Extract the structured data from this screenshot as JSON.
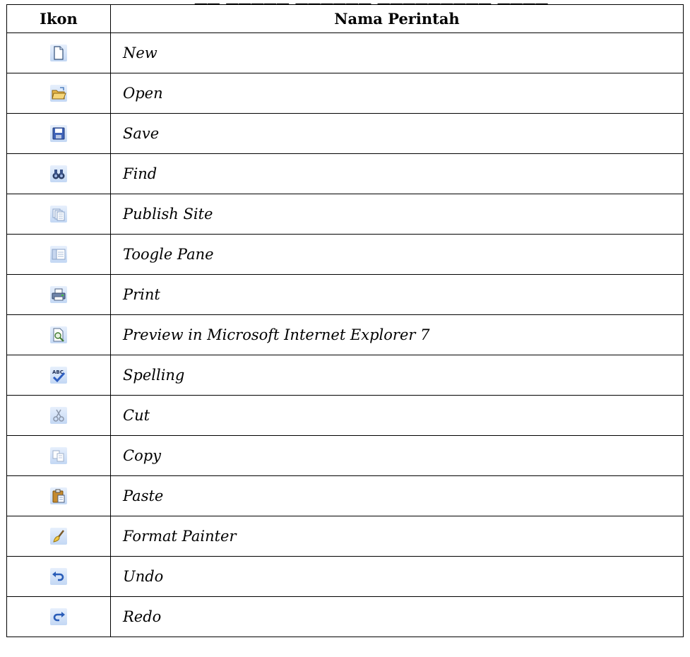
{
  "table": {
    "headers": {
      "icon": "Ikon",
      "name": "Nama Perintah"
    },
    "rows": [
      {
        "icon": "new-document-icon",
        "label": "New"
      },
      {
        "icon": "open-folder-icon",
        "label": "Open"
      },
      {
        "icon": "save-disk-icon",
        "label": "Save"
      },
      {
        "icon": "find-binoculars-icon",
        "label": "Find"
      },
      {
        "icon": "publish-site-icon",
        "label": "Publish Site"
      },
      {
        "icon": "toggle-pane-icon",
        "label": "Toogle Pane"
      },
      {
        "icon": "printer-icon",
        "label": "Print"
      },
      {
        "icon": "preview-browser-icon",
        "label": "Preview in Microsoft Internet Explorer 7"
      },
      {
        "icon": "spelling-check-icon",
        "label": "Spelling"
      },
      {
        "icon": "cut-scissors-icon",
        "label": "Cut"
      },
      {
        "icon": "copy-icon",
        "label": "Copy"
      },
      {
        "icon": "paste-clipboard-icon",
        "label": "Paste"
      },
      {
        "icon": "format-painter-brush-icon",
        "label": "Format Painter"
      },
      {
        "icon": "undo-arrow-icon",
        "label": "Undo"
      },
      {
        "icon": "redo-arrow-icon",
        "label": "Redo"
      }
    ]
  }
}
